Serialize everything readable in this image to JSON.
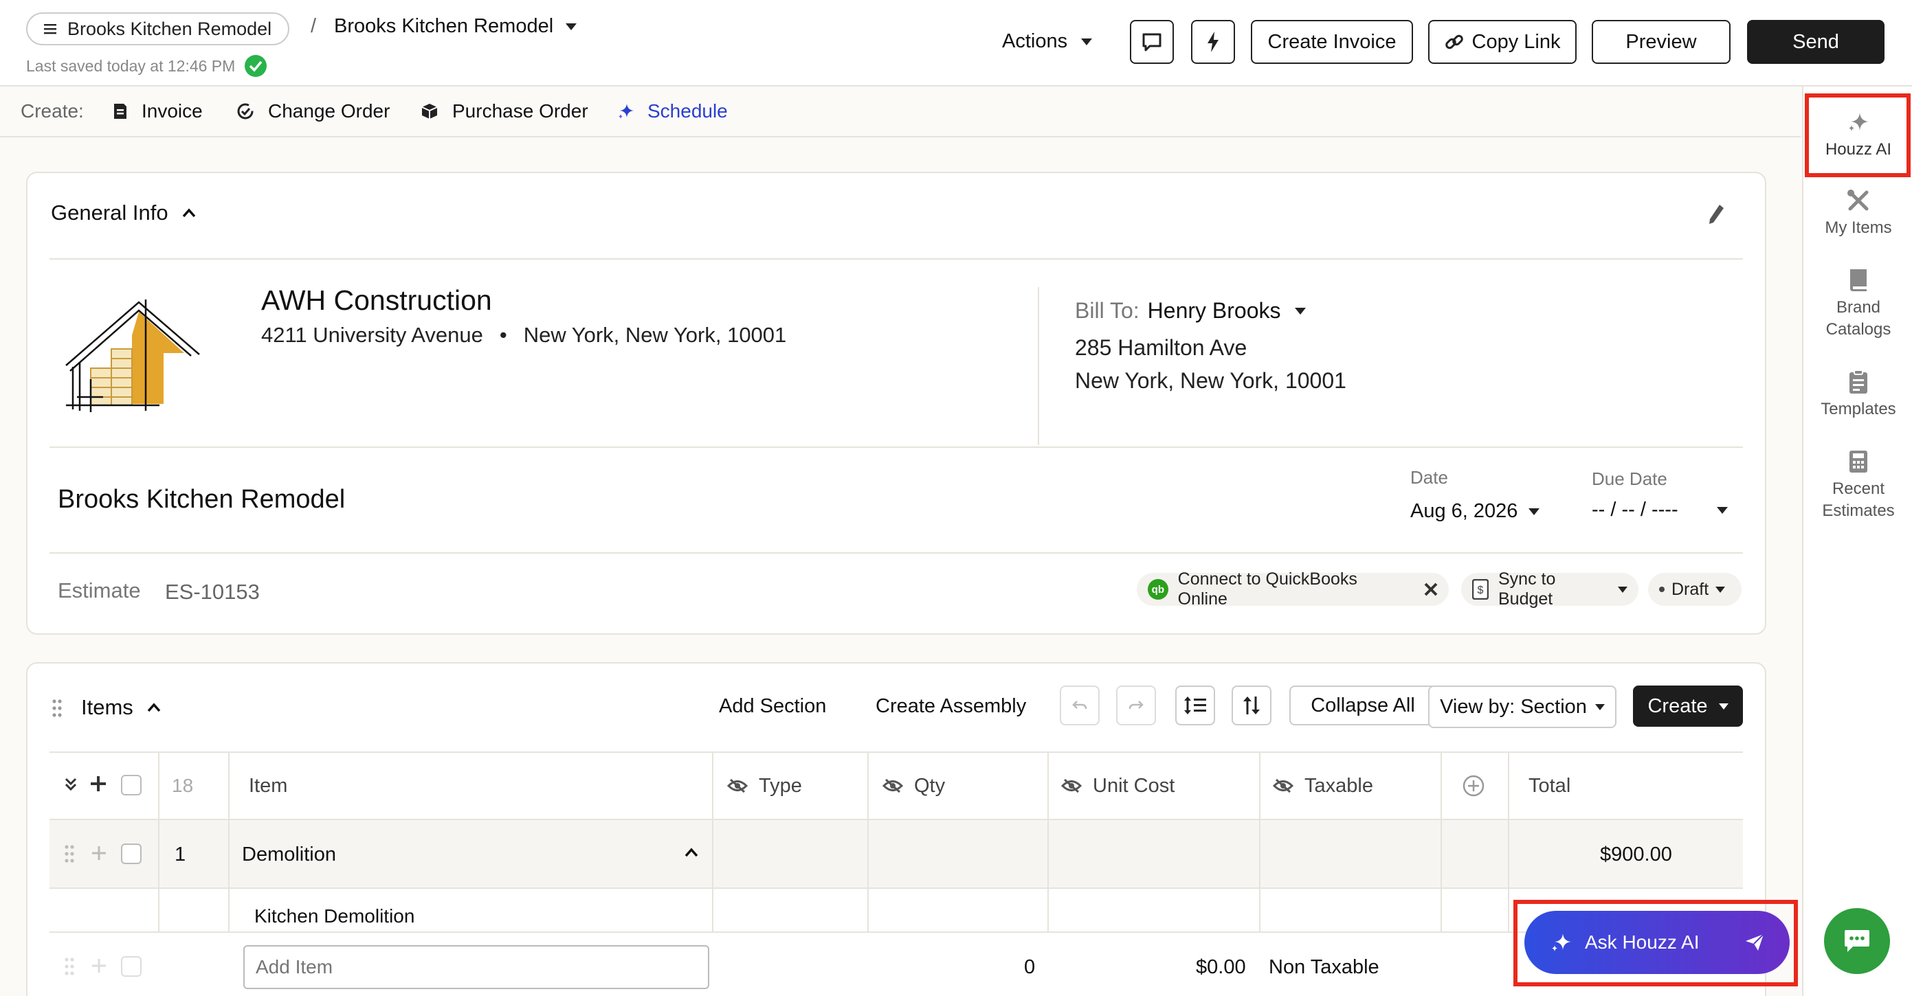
{
  "header": {
    "menu_label": "Brooks Kitchen Remodel",
    "separator": "/",
    "project_title": "Brooks Kitchen Remodel",
    "last_saved": "Last saved today at 12:46 PM",
    "actions_label": "Actions",
    "create_invoice_label": "Create Invoice",
    "copy_link_label": "Copy Link",
    "preview_label": "Preview",
    "send_label": "Send"
  },
  "create_bar": {
    "label": "Create:",
    "items": [
      "Invoice",
      "Change Order",
      "Purchase Order",
      "Schedule"
    ]
  },
  "right_rail": {
    "items": [
      {
        "label": "Houzz AI",
        "icon": "sparkle-icon"
      },
      {
        "label": "My Items",
        "icon": "tools-icon"
      },
      {
        "label": "Brand Catalogs",
        "icon": "book-icon"
      },
      {
        "label": "Templates",
        "icon": "clipboard-icon"
      },
      {
        "label": "Recent Estimates",
        "icon": "calculator-icon"
      }
    ]
  },
  "general_info": {
    "title": "General Info",
    "company_name": "AWH Construction",
    "company_street": "4211 University Avenue",
    "company_bullet": "•",
    "company_city": "New York, New York, 10001",
    "bill_to_label": "Bill To:",
    "bill_to_name": "Henry Brooks",
    "bill_to_street": "285 Hamilton Ave",
    "bill_to_city": "New York, New York, 10001",
    "project_name": "Brooks Kitchen Remodel",
    "date_label": "Date",
    "date_value": "Aug 6, 2026",
    "due_date_label": "Due Date",
    "due_date_value": "-- / -- / ----",
    "estimate_label": "Estimate",
    "estimate_number": "ES-10153",
    "qb_label": "Connect to QuickBooks Online",
    "qb_badge": "qb",
    "sync_label": "Sync to Budget",
    "status_label": "Draft"
  },
  "items": {
    "title": "Items",
    "add_section_label": "Add Section",
    "create_assembly_label": "Create Assembly",
    "collapse_all_label": "Collapse All",
    "view_by_label": "View by: Section",
    "create_label": "Create",
    "count": "18",
    "columns": {
      "item": "Item",
      "type": "Type",
      "qty": "Qty",
      "unit_cost": "Unit Cost",
      "taxable": "Taxable",
      "total": "Total"
    },
    "section_row": {
      "number": "1",
      "name": "Demolition",
      "total": "$900.00"
    },
    "sub_row": {
      "name": "Kitchen Demolition"
    },
    "add_row": {
      "placeholder": "Add Item",
      "qty": "0",
      "unit_cost": "$0.00",
      "taxable": "Non Taxable"
    }
  },
  "ai_button": {
    "label": "Ask Houzz AI"
  },
  "colors": {
    "accent_blue": "#2a3fcf",
    "highlight_red": "#e8291c",
    "chat_green": "#2e9e3e",
    "success_green": "#29b34a",
    "qb_green": "#2ca01c"
  }
}
